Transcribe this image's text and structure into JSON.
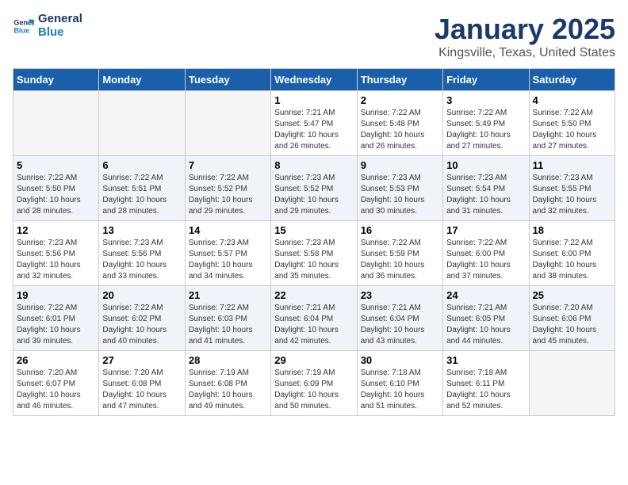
{
  "header": {
    "logo_line1": "General",
    "logo_line2": "Blue",
    "title": "January 2025",
    "subtitle": "Kingsville, Texas, United States"
  },
  "weekdays": [
    "Sunday",
    "Monday",
    "Tuesday",
    "Wednesday",
    "Thursday",
    "Friday",
    "Saturday"
  ],
  "weeks": [
    [
      {
        "num": "",
        "info": ""
      },
      {
        "num": "",
        "info": ""
      },
      {
        "num": "",
        "info": ""
      },
      {
        "num": "1",
        "info": "Sunrise: 7:21 AM\nSunset: 5:47 PM\nDaylight: 10 hours\nand 26 minutes."
      },
      {
        "num": "2",
        "info": "Sunrise: 7:22 AM\nSunset: 5:48 PM\nDaylight: 10 hours\nand 26 minutes."
      },
      {
        "num": "3",
        "info": "Sunrise: 7:22 AM\nSunset: 5:49 PM\nDaylight: 10 hours\nand 27 minutes."
      },
      {
        "num": "4",
        "info": "Sunrise: 7:22 AM\nSunset: 5:50 PM\nDaylight: 10 hours\nand 27 minutes."
      }
    ],
    [
      {
        "num": "5",
        "info": "Sunrise: 7:22 AM\nSunset: 5:50 PM\nDaylight: 10 hours\nand 28 minutes."
      },
      {
        "num": "6",
        "info": "Sunrise: 7:22 AM\nSunset: 5:51 PM\nDaylight: 10 hours\nand 28 minutes."
      },
      {
        "num": "7",
        "info": "Sunrise: 7:22 AM\nSunset: 5:52 PM\nDaylight: 10 hours\nand 29 minutes."
      },
      {
        "num": "8",
        "info": "Sunrise: 7:23 AM\nSunset: 5:52 PM\nDaylight: 10 hours\nand 29 minutes."
      },
      {
        "num": "9",
        "info": "Sunrise: 7:23 AM\nSunset: 5:53 PM\nDaylight: 10 hours\nand 30 minutes."
      },
      {
        "num": "10",
        "info": "Sunrise: 7:23 AM\nSunset: 5:54 PM\nDaylight: 10 hours\nand 31 minutes."
      },
      {
        "num": "11",
        "info": "Sunrise: 7:23 AM\nSunset: 5:55 PM\nDaylight: 10 hours\nand 32 minutes."
      }
    ],
    [
      {
        "num": "12",
        "info": "Sunrise: 7:23 AM\nSunset: 5:56 PM\nDaylight: 10 hours\nand 32 minutes."
      },
      {
        "num": "13",
        "info": "Sunrise: 7:23 AM\nSunset: 5:56 PM\nDaylight: 10 hours\nand 33 minutes."
      },
      {
        "num": "14",
        "info": "Sunrise: 7:23 AM\nSunset: 5:57 PM\nDaylight: 10 hours\nand 34 minutes."
      },
      {
        "num": "15",
        "info": "Sunrise: 7:23 AM\nSunset: 5:58 PM\nDaylight: 10 hours\nand 35 minutes."
      },
      {
        "num": "16",
        "info": "Sunrise: 7:22 AM\nSunset: 5:59 PM\nDaylight: 10 hours\nand 36 minutes."
      },
      {
        "num": "17",
        "info": "Sunrise: 7:22 AM\nSunset: 6:00 PM\nDaylight: 10 hours\nand 37 minutes."
      },
      {
        "num": "18",
        "info": "Sunrise: 7:22 AM\nSunset: 6:00 PM\nDaylight: 10 hours\nand 38 minutes."
      }
    ],
    [
      {
        "num": "19",
        "info": "Sunrise: 7:22 AM\nSunset: 6:01 PM\nDaylight: 10 hours\nand 39 minutes."
      },
      {
        "num": "20",
        "info": "Sunrise: 7:22 AM\nSunset: 6:02 PM\nDaylight: 10 hours\nand 40 minutes."
      },
      {
        "num": "21",
        "info": "Sunrise: 7:22 AM\nSunset: 6:03 PM\nDaylight: 10 hours\nand 41 minutes."
      },
      {
        "num": "22",
        "info": "Sunrise: 7:21 AM\nSunset: 6:04 PM\nDaylight: 10 hours\nand 42 minutes."
      },
      {
        "num": "23",
        "info": "Sunrise: 7:21 AM\nSunset: 6:04 PM\nDaylight: 10 hours\nand 43 minutes."
      },
      {
        "num": "24",
        "info": "Sunrise: 7:21 AM\nSunset: 6:05 PM\nDaylight: 10 hours\nand 44 minutes."
      },
      {
        "num": "25",
        "info": "Sunrise: 7:20 AM\nSunset: 6:06 PM\nDaylight: 10 hours\nand 45 minutes."
      }
    ],
    [
      {
        "num": "26",
        "info": "Sunrise: 7:20 AM\nSunset: 6:07 PM\nDaylight: 10 hours\nand 46 minutes."
      },
      {
        "num": "27",
        "info": "Sunrise: 7:20 AM\nSunset: 6:08 PM\nDaylight: 10 hours\nand 47 minutes."
      },
      {
        "num": "28",
        "info": "Sunrise: 7:19 AM\nSunset: 6:08 PM\nDaylight: 10 hours\nand 49 minutes."
      },
      {
        "num": "29",
        "info": "Sunrise: 7:19 AM\nSunset: 6:09 PM\nDaylight: 10 hours\nand 50 minutes."
      },
      {
        "num": "30",
        "info": "Sunrise: 7:18 AM\nSunset: 6:10 PM\nDaylight: 10 hours\nand 51 minutes."
      },
      {
        "num": "31",
        "info": "Sunrise: 7:18 AM\nSunset: 6:11 PM\nDaylight: 10 hours\nand 52 minutes."
      },
      {
        "num": "",
        "info": ""
      }
    ]
  ]
}
